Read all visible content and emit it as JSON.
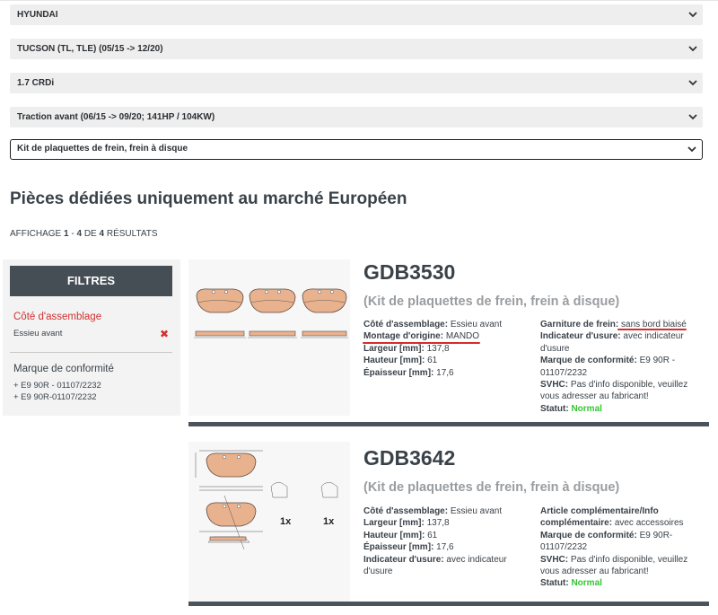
{
  "selectors": [
    {
      "value": "HYUNDAI"
    },
    {
      "value": "TUCSON (TL, TLE) (05/15 -> 12/20)"
    },
    {
      "value": "1.7 CRDi"
    },
    {
      "value": "Traction avant (06/15 -> 09/20; 141HP / 104KW)"
    },
    {
      "value": "Kit de plaquettes de frein, frein à disque"
    }
  ],
  "heading": "Pièces dédiées uniquement au marché Européen",
  "results": {
    "prefix": "AFFICHAGE",
    "from": "1",
    "sep1": "-",
    "to": "4",
    "sep2": "DE",
    "total": "4",
    "suffix": "RÉSULTATS"
  },
  "filters": {
    "title": "FILTRES",
    "groups": [
      {
        "title": "Côté d'assemblage",
        "items": [
          "Essieu avant"
        ],
        "remove_icon": "close-x-icon"
      },
      {
        "title": "Marque de conformité",
        "items": [
          "+ E9 90R - 01107/2232",
          "+ E9 90R-01107/2232"
        ]
      }
    ]
  },
  "products": [
    {
      "code": "GDB3530",
      "subtitle": "(Kit de plaquettes de frein, frein à disque)",
      "left": [
        {
          "label": "Côté d'assemblage:",
          "value": "Essieu avant"
        },
        {
          "label": "Montage d'origine:",
          "value": "MANDO"
        },
        {
          "label": "Largeur [mm]:",
          "value": "137,8"
        },
        {
          "label": "Hauteur [mm]:",
          "value": "61"
        },
        {
          "label": "Épaisseur [mm]:",
          "value": "17,6"
        }
      ],
      "right": [
        {
          "label": "Garniture de frein:",
          "value": "sans bord biaisé"
        },
        {
          "label": "Indicateur d'usure:",
          "value": "avec indicateur d'usure"
        },
        {
          "label": "Marque de conformité:",
          "value": "E9 90R - 01107/2232"
        },
        {
          "label": "SVHC:",
          "value": "Pas d'info disponible, veuillez vous adresser au fabricant!"
        },
        {
          "label": "Statut:",
          "value": "Normal"
        }
      ]
    },
    {
      "code": "GDB3642",
      "subtitle": "(Kit de plaquettes de frein, frein à disque)",
      "image_labels": [
        "1x",
        "1x"
      ],
      "left": [
        {
          "label": "Côté d'assemblage:",
          "value": "Essieu avant"
        },
        {
          "label": "Largeur [mm]:",
          "value": "137,8"
        },
        {
          "label": "Hauteur [mm]:",
          "value": "61"
        },
        {
          "label": "Épaisseur [mm]:",
          "value": "17,6"
        },
        {
          "label": "Indicateur d'usure:",
          "value": "avec indicateur d'usure"
        }
      ],
      "right": [
        {
          "label": "Article complémentaire/Info complémentaire:",
          "value": "avec accessoires"
        },
        {
          "label": "Marque de conformité:",
          "value": "E9 90R-01107/2232"
        },
        {
          "label": "SVHC:",
          "value": "Pas d'info disponible, veuillez vous adresser au fabricant!"
        },
        {
          "label": "Statut:",
          "value": "Normal"
        }
      ]
    }
  ],
  "colors": {
    "accent_red": "#d32f2f",
    "status_green": "#34c434",
    "header_dark": "#454d55",
    "pad_fill": "#e9b28f"
  }
}
